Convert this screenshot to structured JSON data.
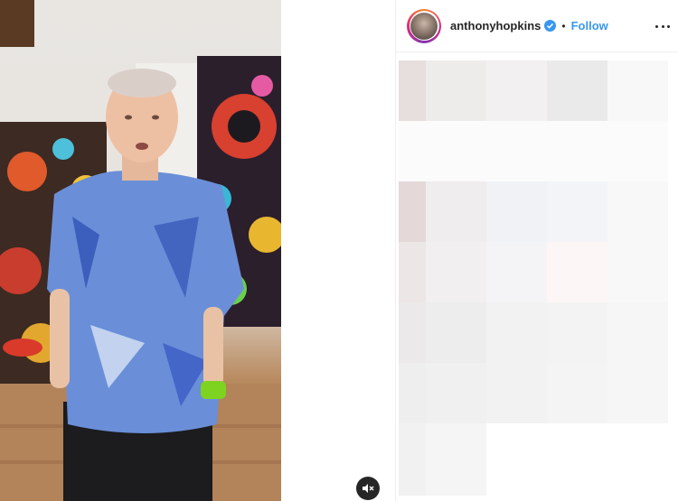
{
  "post": {
    "username": "anthonyhopkins",
    "dot": "•",
    "follow_label": "Follow",
    "verified": true
  },
  "icons": {
    "mute": "speaker-muted-icon",
    "more": "more-options-icon",
    "verified": "verified-badge-icon"
  },
  "colors": {
    "link_blue": "#3897f0",
    "text_dark": "#262626"
  }
}
